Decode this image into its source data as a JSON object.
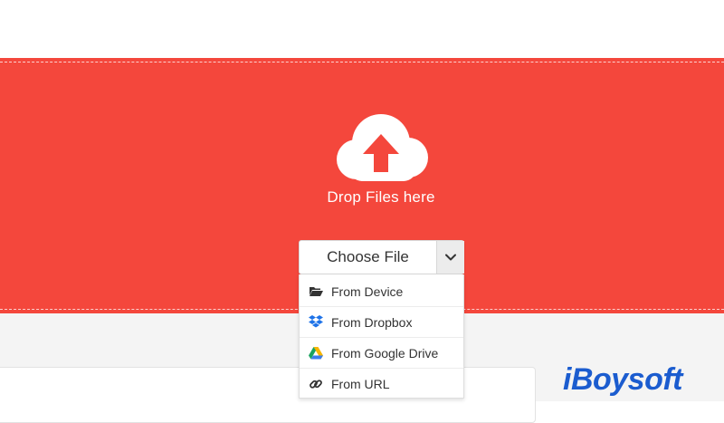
{
  "dropzone": {
    "label": "Drop Files here"
  },
  "chooser": {
    "button_label": "Choose File",
    "menu": [
      {
        "label": "From Device",
        "icon": "folder-open-icon"
      },
      {
        "label": "From Dropbox",
        "icon": "dropbox-icon"
      },
      {
        "label": "From Google Drive",
        "icon": "google-drive-icon"
      },
      {
        "label": "From URL",
        "icon": "link-icon"
      }
    ]
  },
  "watermark": {
    "text": "iBoysoft"
  },
  "colors": {
    "accent": "#f4473c",
    "brand": "#1b5ccf"
  }
}
